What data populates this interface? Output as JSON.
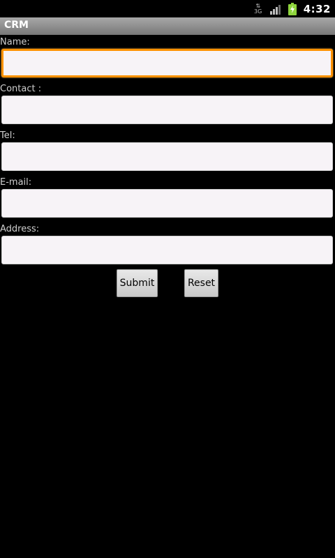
{
  "status_bar": {
    "time": "4:32",
    "network_type": "3G",
    "network_icon": "data-arrows-icon",
    "signal_icon": "signal-bars-icon",
    "battery_icon": "battery-charging-icon"
  },
  "app": {
    "title": "CRM"
  },
  "form": {
    "fields": [
      {
        "label": "Name:",
        "value": "",
        "placeholder": ""
      },
      {
        "label": "Contact :",
        "value": "",
        "placeholder": ""
      },
      {
        "label": "Tel:",
        "value": "",
        "placeholder": ""
      },
      {
        "label": "E-mail:",
        "value": "",
        "placeholder": ""
      },
      {
        "label": "Address:",
        "value": "",
        "placeholder": ""
      }
    ],
    "submit_label": "Submit",
    "reset_label": "Reset"
  },
  "colors": {
    "focus_accent": "#ff9200",
    "background": "#000000",
    "field_background": "#f7f3f7",
    "battery_green": "#8ed43c"
  }
}
